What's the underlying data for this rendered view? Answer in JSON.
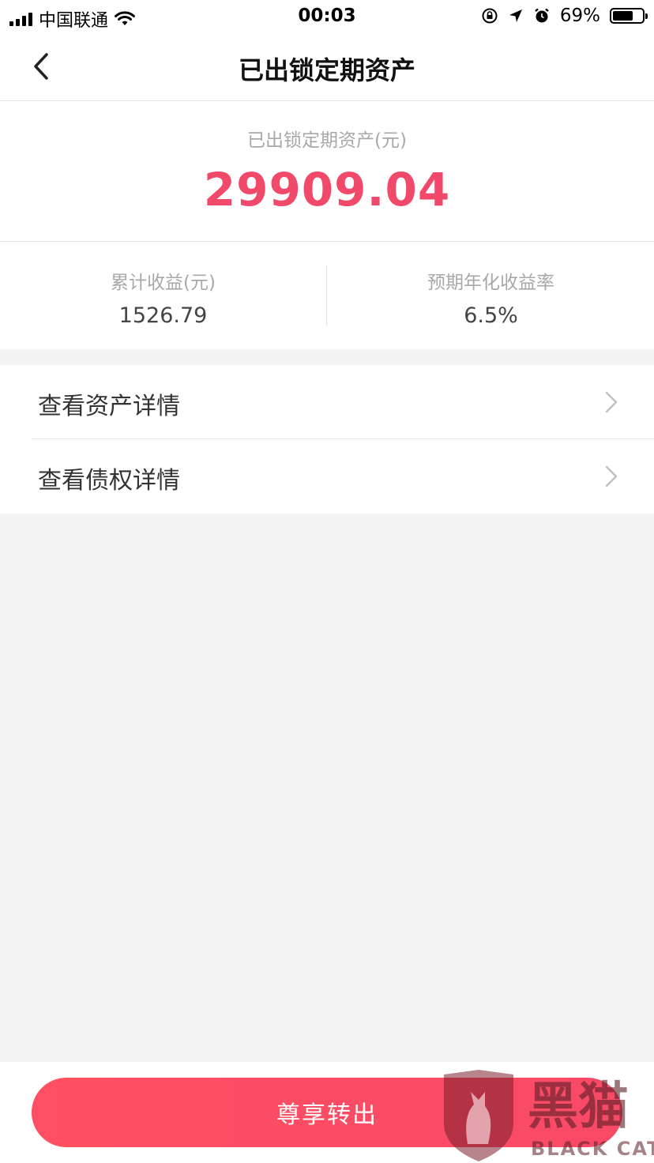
{
  "status_bar": {
    "carrier": "中国联通",
    "time": "00:03",
    "battery_percent": "69%",
    "battery_level": 0.69,
    "icons": [
      "signal-icon",
      "wifi-icon",
      "rotation-lock-icon",
      "location-icon",
      "alarm-icon",
      "battery-icon"
    ]
  },
  "nav": {
    "title": "已出锁定期资产",
    "back_icon": "chevron-left-icon"
  },
  "summary": {
    "label": "已出锁定期资产(元)",
    "amount": "29909.04"
  },
  "stats": {
    "cumulative": {
      "label": "累计收益(元)",
      "value": "1526.79"
    },
    "annual_rate": {
      "label": "预期年化收益率",
      "value": "6.5%"
    }
  },
  "menu": {
    "items": [
      {
        "label": "查看资产详情",
        "icon": "chevron-right-icon"
      },
      {
        "label": "查看债权详情",
        "icon": "chevron-right-icon"
      }
    ]
  },
  "action": {
    "label": "尊享转出"
  },
  "watermark": {
    "cn": "黑猫",
    "en": "BLACK CAT"
  },
  "colors": {
    "accent": "#f1496a",
    "button": "#ff4f62",
    "background": "#f4f4f4",
    "muted": "#a8a8a8"
  }
}
